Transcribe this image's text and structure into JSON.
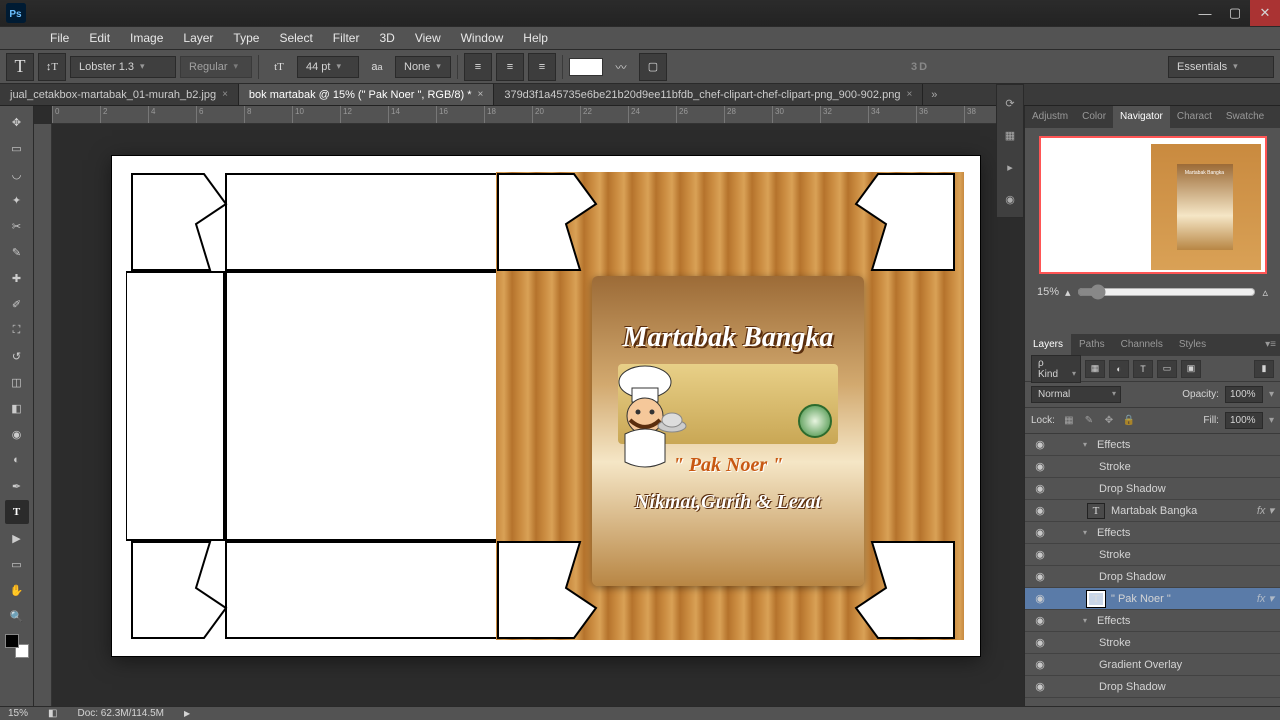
{
  "menu": {
    "items": [
      "File",
      "Edit",
      "Image",
      "Layer",
      "Type",
      "Select",
      "Filter",
      "3D",
      "View",
      "Window",
      "Help"
    ]
  },
  "optbar": {
    "font": "Lobster 1.3",
    "weight": "Regular",
    "size": "44 pt",
    "aa": "None",
    "threed": "3D",
    "workspace": "Essentials"
  },
  "tabs": [
    {
      "label": "jual_cetakbox-martabak_01-murah_b2.jpg",
      "active": false
    },
    {
      "label": "bok martabak @ 15% (\" Pak Noer \", RGB/8) *",
      "active": true
    },
    {
      "label": "379d3f1a45735e6be21b20d9ee11bfdb_chef-clipart-chef-clipart-png_900-902.png",
      "active": false
    }
  ],
  "ruler": {
    "ticks": [
      "0",
      "2",
      "4",
      "6",
      "8",
      "10",
      "12",
      "14",
      "16",
      "18",
      "20",
      "22",
      "24",
      "26",
      "28",
      "30",
      "32",
      "34",
      "36",
      "38"
    ]
  },
  "art": {
    "title": "Martabak Bangka",
    "brand": "\" Pak Noer \"",
    "tagline": "Nikmat,Gurih & Lezat"
  },
  "nav": {
    "zoom": "15%"
  },
  "panelTabs1": [
    "Adjustm",
    "Color",
    "Navigator",
    "Charact",
    "Swatche"
  ],
  "layerTabs": [
    "Layers",
    "Paths",
    "Channels",
    "Styles"
  ],
  "layerFilter": {
    "kind_label": "Kind"
  },
  "blend": {
    "mode": "Normal",
    "opacity_label": "Opacity:",
    "opacity": "100%"
  },
  "lock": {
    "label": "Lock:",
    "fill_label": "Fill:",
    "fill": "100%"
  },
  "layers": [
    {
      "type": "sub",
      "label": "Effects",
      "indent": 1,
      "tri": "▾"
    },
    {
      "type": "sub",
      "label": "Stroke",
      "indent": 2
    },
    {
      "type": "sub",
      "label": "Drop Shadow",
      "indent": 2
    },
    {
      "type": "text",
      "label": "Martabak Bangka",
      "indent": 0,
      "eye": true,
      "fx": true,
      "tri": ""
    },
    {
      "type": "sub",
      "label": "Effects",
      "indent": 1,
      "tri": "▾"
    },
    {
      "type": "sub",
      "label": "Stroke",
      "indent": 2
    },
    {
      "type": "sub",
      "label": "Drop Shadow",
      "indent": 2
    },
    {
      "type": "text",
      "label": "\" Pak Noer \"",
      "indent": 0,
      "eye": true,
      "fx": true,
      "selected": true,
      "tri": ""
    },
    {
      "type": "sub",
      "label": "Effects",
      "indent": 1,
      "tri": "▾"
    },
    {
      "type": "sub",
      "label": "Stroke",
      "indent": 2
    },
    {
      "type": "sub",
      "label": "Gradient Overlay",
      "indent": 2
    },
    {
      "type": "sub",
      "label": "Drop Shadow",
      "indent": 2
    }
  ],
  "status": {
    "zoom": "15%",
    "doc": "Doc: 62.3M/114.5M"
  }
}
